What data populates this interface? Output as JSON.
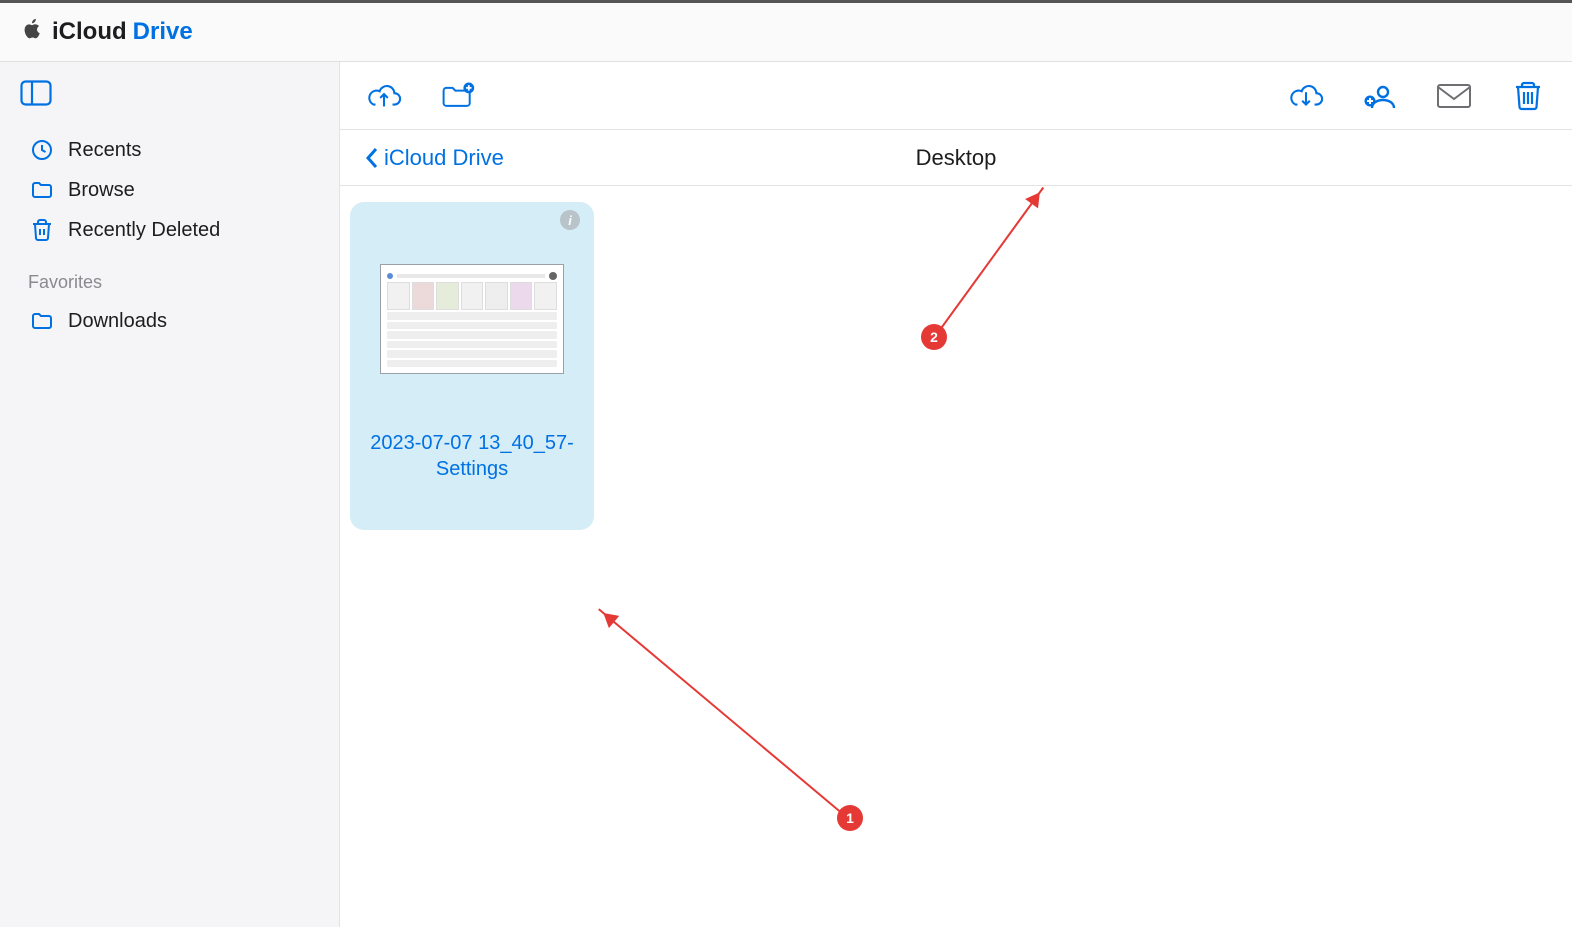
{
  "header": {
    "brand_icloud": "iCloud",
    "brand_drive": "Drive"
  },
  "sidebar": {
    "recents": "Recents",
    "browse": "Browse",
    "recently_deleted": "Recently Deleted",
    "favorites_label": "Favorites",
    "downloads": "Downloads"
  },
  "breadcrumb": {
    "back_label": "iCloud Drive",
    "current": "Desktop"
  },
  "files": [
    {
      "name": "2023-07-07 13_40_57-Settings"
    }
  ],
  "annotations": [
    {
      "id": "1"
    },
    {
      "id": "2"
    }
  ],
  "colors": {
    "primary": "#0071e3",
    "selection_bg": "#d4edf6",
    "annotation": "#e53935"
  }
}
